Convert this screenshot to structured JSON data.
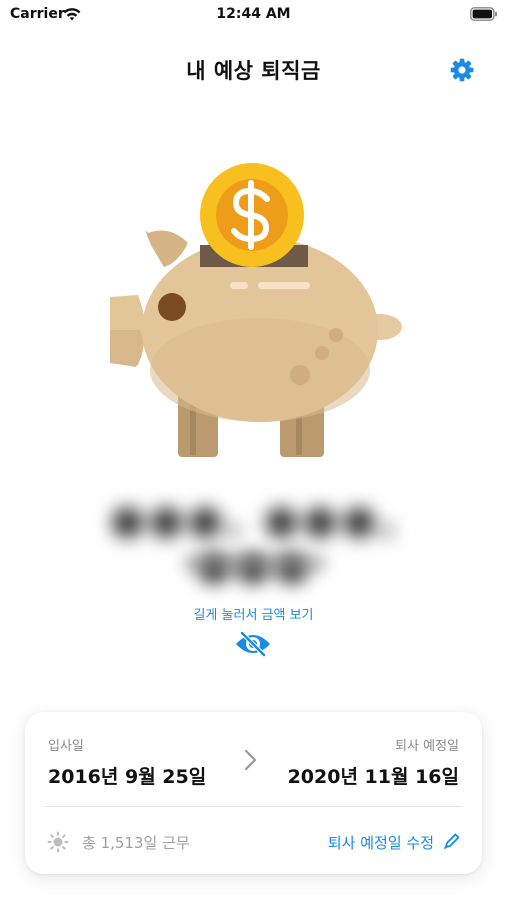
{
  "status_bar": {
    "carrier": "Carrier",
    "time": "12:44 AM",
    "icons": [
      "wifi-icon",
      "battery-icon"
    ]
  },
  "nav": {
    "title": "내 예상 퇴직금",
    "settings_icon": "gear-icon"
  },
  "hero": {
    "illustration": "piggy-bank-with-dollar-coin",
    "amount_hidden": true,
    "amount_placeholder": "●●●, ●●●, ●●●",
    "sub_placeholder": "●●●●●●●●●"
  },
  "reveal": {
    "hint": "길게 눌러서 금액 보기",
    "icon": "eye-slash-icon"
  },
  "card": {
    "start_label": "입사일",
    "start_date": "2016년 9월 25일",
    "end_label": "퇴사 예정일",
    "end_date": "2020년 11월 16일",
    "arrow_icon": "chevron-right-icon",
    "total": "총 1,513일 근무",
    "total_icon": "sun-icon",
    "edit_label": "퇴사 예정일 수정",
    "edit_icon": "pencil-icon"
  },
  "colors": {
    "accent": "#1a8ae5",
    "coin": "#f7c01e",
    "pig": "#e3c59a"
  }
}
